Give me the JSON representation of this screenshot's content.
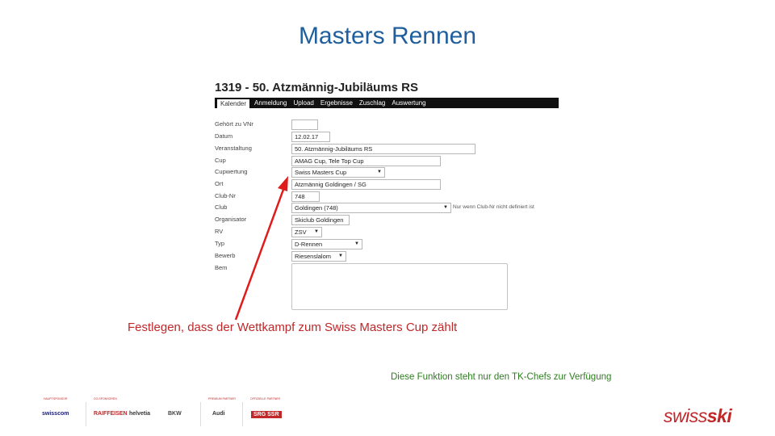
{
  "slide": {
    "title": "Masters Rennen"
  },
  "form": {
    "heading": "1319 - 50. Atzmännig-Jubiläums RS",
    "tabs": [
      {
        "label": "Kalender",
        "active": true
      },
      {
        "label": "Anmeldung"
      },
      {
        "label": "Upload"
      },
      {
        "label": "Ergebnisse"
      },
      {
        "label": "Zuschlag"
      },
      {
        "label": "Auswertung"
      }
    ],
    "fields": {
      "gehoert_zu_vnr": {
        "label": "Gehört zu VNr",
        "value": ""
      },
      "datum": {
        "label": "Datum",
        "value": "12.02.17"
      },
      "veranstaltung": {
        "label": "Veranstaltung",
        "value": "50. Atzmännig-Jubiläums RS"
      },
      "cup": {
        "label": "Cup",
        "value": "AMAG Cup, Tele Top Cup"
      },
      "cupwertung": {
        "label": "Cupwertung",
        "value": "Swiss Masters Cup"
      },
      "ort": {
        "label": "Ort",
        "value": "Atzmännig Goldingen / SG"
      },
      "club_nr": {
        "label": "Club-Nr",
        "value": "748"
      },
      "club": {
        "label": "Club",
        "value": "Goldingen (748)",
        "hint": "Nur wenn Club-Nr nicht definiert ist"
      },
      "organisator": {
        "label": "Organisator",
        "value": "Skiclub Goldingen"
      },
      "rv": {
        "label": "RV",
        "value": "ZSV"
      },
      "typ": {
        "label": "Typ",
        "value": "D-Rennen"
      },
      "bewerb": {
        "label": "Bewerb",
        "value": "Riesenslalom"
      },
      "bem": {
        "label": "Bem",
        "value": ""
      }
    }
  },
  "annotation": {
    "text": "Festlegen, dass der Wettkampf zum Swiss Masters Cup zählt",
    "color": "#c0282a"
  },
  "note": {
    "text": "Diese Funktion steht nur den TK-Chefs zur Verfügung",
    "color": "#2d7d1f"
  },
  "sponsors": {
    "captions": [
      "HAUPTSPONSOR",
      "CO-SPONSOREN",
      "PREMIUM PARTNER",
      "OFFIZIELLE PARTNER"
    ],
    "logos": [
      "swisscom",
      "RAIFFEISEN",
      "helvetia",
      "BKW",
      "Audi",
      "SRG SSR"
    ]
  },
  "brand": {
    "prefix": "swiss",
    "suffix": "ski",
    "color": "#c0282a"
  }
}
